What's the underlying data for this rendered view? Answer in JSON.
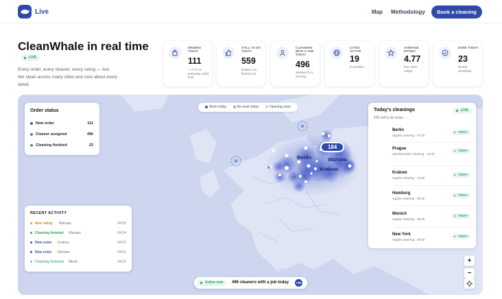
{
  "header": {
    "brand": "Live",
    "nav": [
      "Map",
      "Methodology"
    ],
    "cta": "Book a cleaning"
  },
  "hero": {
    "title": "CleanWhale in real time",
    "live": "LIVE",
    "sub1": "Every order, every cleaner, every rating — live.",
    "sub2": "We clean across many cities and care about every detail."
  },
  "stats": [
    {
      "label": "ORDERS TODAY",
      "value": "111",
      "note": "↗ 4.7% vs yesterday at this hour"
    },
    {
      "label": "STILL TO DO TODAY",
      "value": "559",
      "note": "booked, not finished yet"
    },
    {
      "label": "CLEANERS WITH A JOB TODAY",
      "value": "496",
      "note": "assigned to a cleaning"
    },
    {
      "label": "CITIES ACTIVE",
      "value": "19",
      "note": "8 countries"
    },
    {
      "label": "AVERAGE RATING",
      "value": "4.77",
      "note": "from 4642 ratings"
    },
    {
      "label": "DONE TODAY",
      "value": "23",
      "note": "already completed"
    }
  ],
  "map": {
    "legend": [
      "Work today",
      "No work today",
      "Opening soon"
    ],
    "bubble": "184",
    "city_labels": [
      "Berlin",
      "Warsaw",
      "Krakow"
    ]
  },
  "order_status": {
    "title": "Order status",
    "rows": [
      {
        "label": "New order",
        "value": "111",
        "color": "#3f51b5"
      },
      {
        "label": "Cleaner assigned",
        "value": "496",
        "color": "#5b6fc9"
      },
      {
        "label": "Cleaning finished",
        "value": "23",
        "color": "#3ea36a"
      }
    ]
  },
  "recent": {
    "title": "RECENT ACTIVITY",
    "items": [
      {
        "label": "New rating",
        "city": "Warsaw",
        "time": "04:25",
        "color": "#d9a520"
      },
      {
        "label": "Cleaning finished",
        "city": "Warsaw",
        "time": "04:24",
        "color": "#3ea36a"
      },
      {
        "label": "New order",
        "city": "Krakow",
        "time": "04:22",
        "color": "#3f51b5"
      },
      {
        "label": "New order",
        "city": "Warsaw",
        "time": "04:21",
        "color": "#3f51b5"
      },
      {
        "label": "Cleaning finished",
        "city": "Minsk",
        "time": "04:21",
        "color": "#3ea36a"
      }
    ]
  },
  "today": {
    "title": "Today's cleanings",
    "live": "LIVE",
    "sub": "559 still to do today",
    "items": [
      {
        "city": "Berlin",
        "detail": "regular cleaning · 07:30",
        "badge": "TODAY"
      },
      {
        "city": "Prague",
        "detail": "upholstery/dry cleaning · 18:30",
        "badge": "TODAY"
      },
      {
        "city": "Krakow",
        "detail": "regular cleaning · 13:00",
        "badge": "TODAY"
      },
      {
        "city": "Hamburg",
        "detail": "regular cleaning · 09:30",
        "badge": "TODAY"
      },
      {
        "city": "Munich",
        "detail": "regular cleaning · 09:00",
        "badge": "TODAY"
      },
      {
        "city": "New York",
        "detail": "regular cleaning · 09:00",
        "badge": "TODAY"
      }
    ]
  },
  "bottom": {
    "live": "Active now",
    "text": "496 cleaners with a job today",
    "plus": "+99"
  },
  "zoom": {
    "in": "+",
    "out": "−"
  }
}
